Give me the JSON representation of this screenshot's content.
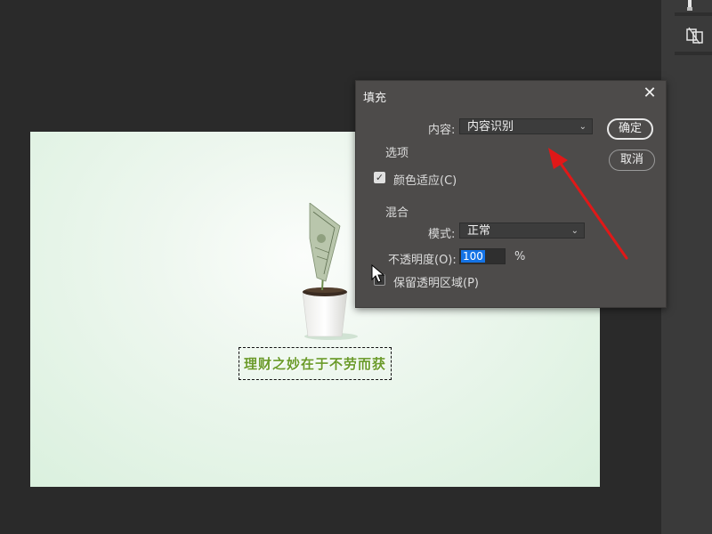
{
  "dialog": {
    "title": "填充",
    "content_label": "内容:",
    "content_value": "内容识别",
    "ok_label": "确定",
    "cancel_label": "取消",
    "options_heading": "选项",
    "color_adapt_label": "颜色适应(C)",
    "color_adapt_checked": true,
    "blend_heading": "混合",
    "mode_label": "模式:",
    "mode_value": "正常",
    "opacity_label": "不透明度(O):",
    "opacity_value": "100",
    "opacity_unit": "%",
    "preserve_label": "保留透明区域(P)",
    "preserve_checked": false
  },
  "canvas": {
    "text": "理财之妙在于不劳而获"
  },
  "colors": {
    "annotation_arrow": "#e01818",
    "canvas_text": "#6a9b2a",
    "selection_highlight": "#1473e6"
  },
  "icons": {
    "rail_top": "brush-icon",
    "rail_second": "patch-icon",
    "close": "close-icon",
    "chevron": "chevron-down-icon",
    "cursor": "mouse-pointer-icon"
  }
}
